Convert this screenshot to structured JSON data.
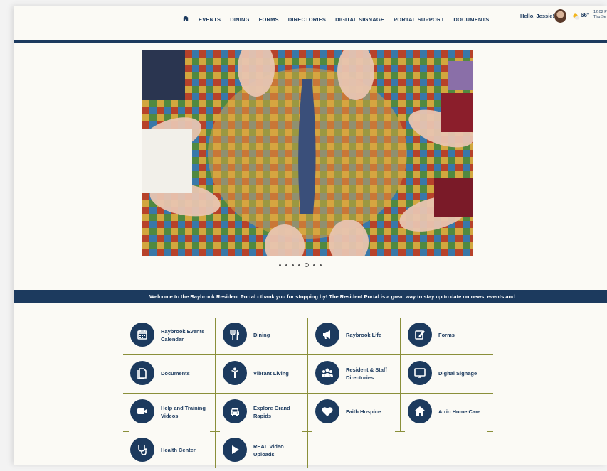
{
  "nav": {
    "home_icon": "home-icon",
    "items": [
      "EVENTS",
      "DINING",
      "FORMS",
      "DIRECTORIES",
      "DIGITAL SIGNAGE",
      "PORTAL SUPPORT",
      "DOCUMENTS"
    ]
  },
  "user": {
    "greeting": "Hello, Jessie!"
  },
  "weather": {
    "icon": "sun-cloud-icon",
    "temp": "66°",
    "time": "12:02 P",
    "date": "Thu Se"
  },
  "carousel": {
    "slide_count": 7,
    "active_index": 4
  },
  "ticker": {
    "text": "Welcome to the Raybrook Resident Portal - thank you for stopping by! The Resident Portal is a great way to stay up to date on news, events and"
  },
  "tiles": [
    {
      "label": "Raybrook Events Calendar",
      "icon": "calendar-icon"
    },
    {
      "label": "Dining",
      "icon": "utensils-icon"
    },
    {
      "label": "Raybrook Life",
      "icon": "megaphone-icon"
    },
    {
      "label": "Forms",
      "icon": "edit-icon"
    },
    {
      "label": "Documents",
      "icon": "documents-icon"
    },
    {
      "label": "Vibrant Living",
      "icon": "person-icon"
    },
    {
      "label": "Resident & Staff Directories",
      "icon": "users-icon"
    },
    {
      "label": "Digital Signage",
      "icon": "monitor-icon"
    },
    {
      "label": "Help and Training Videos",
      "icon": "video-camera-icon"
    },
    {
      "label": "Explore Grand Rapids",
      "icon": "car-icon"
    },
    {
      "label": "Faith Hospice",
      "icon": "heart-icon"
    },
    {
      "label": "Atrio Home Care",
      "icon": "house-icon"
    },
    {
      "label": "Health Center",
      "icon": "stethoscope-icon"
    },
    {
      "label": "REAL Video Uploads",
      "icon": "play-icon"
    }
  ],
  "colors": {
    "navy": "#1c3a5e",
    "olive_divider": "#8a8f3a",
    "background": "#fbfaf5"
  }
}
